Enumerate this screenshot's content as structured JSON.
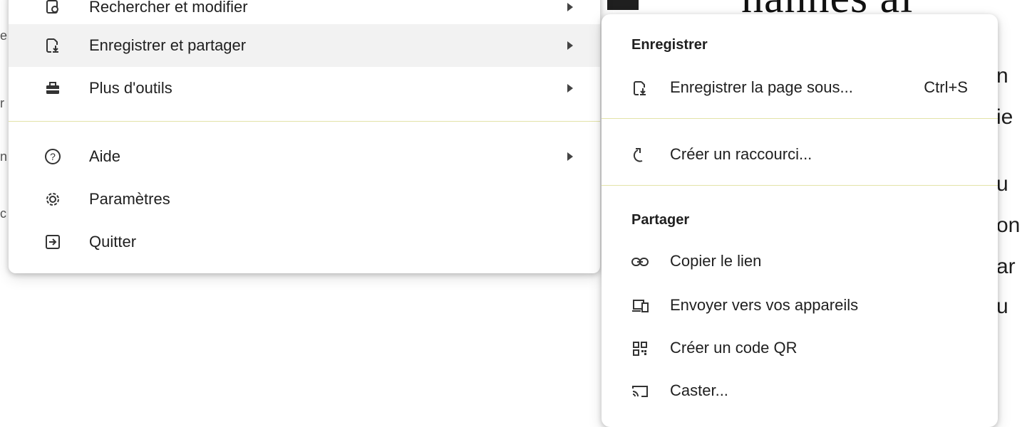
{
  "main_menu": {
    "items": [
      {
        "label": "Rechercher et modifier",
        "icon": "search-edit-icon",
        "has_submenu": true
      },
      {
        "label": "Enregistrer et partager",
        "icon": "save-page-icon",
        "has_submenu": true,
        "highlighted": true
      },
      {
        "label": "Plus d'outils",
        "icon": "toolbox-icon",
        "has_submenu": true
      },
      {
        "label": "Aide",
        "icon": "help-icon",
        "has_submenu": true
      },
      {
        "label": "Paramètres",
        "icon": "gear-icon",
        "has_submenu": false
      },
      {
        "label": "Quitter",
        "icon": "exit-icon",
        "has_submenu": false
      }
    ]
  },
  "submenu": {
    "save_section": {
      "title": "Enregistrer",
      "items": [
        {
          "label": "Enregistrer la page sous...",
          "shortcut": "Ctrl+S",
          "icon": "save-page-icon"
        },
        {
          "label": "Créer un raccourci...",
          "icon": "shortcut-icon"
        }
      ]
    },
    "share_section": {
      "title": "Partager",
      "items": [
        {
          "label": "Copier le lien",
          "icon": "link-icon"
        },
        {
          "label": "Envoyer vers vos appareils",
          "icon": "devices-icon"
        },
        {
          "label": "Créer un code QR",
          "icon": "qr-code-icon"
        },
        {
          "label": "Caster...",
          "icon": "cast-icon"
        }
      ]
    }
  },
  "colors": {
    "separator": "#e3e3a8",
    "hover": "#f2f2f2",
    "text": "#1f1f1f"
  }
}
